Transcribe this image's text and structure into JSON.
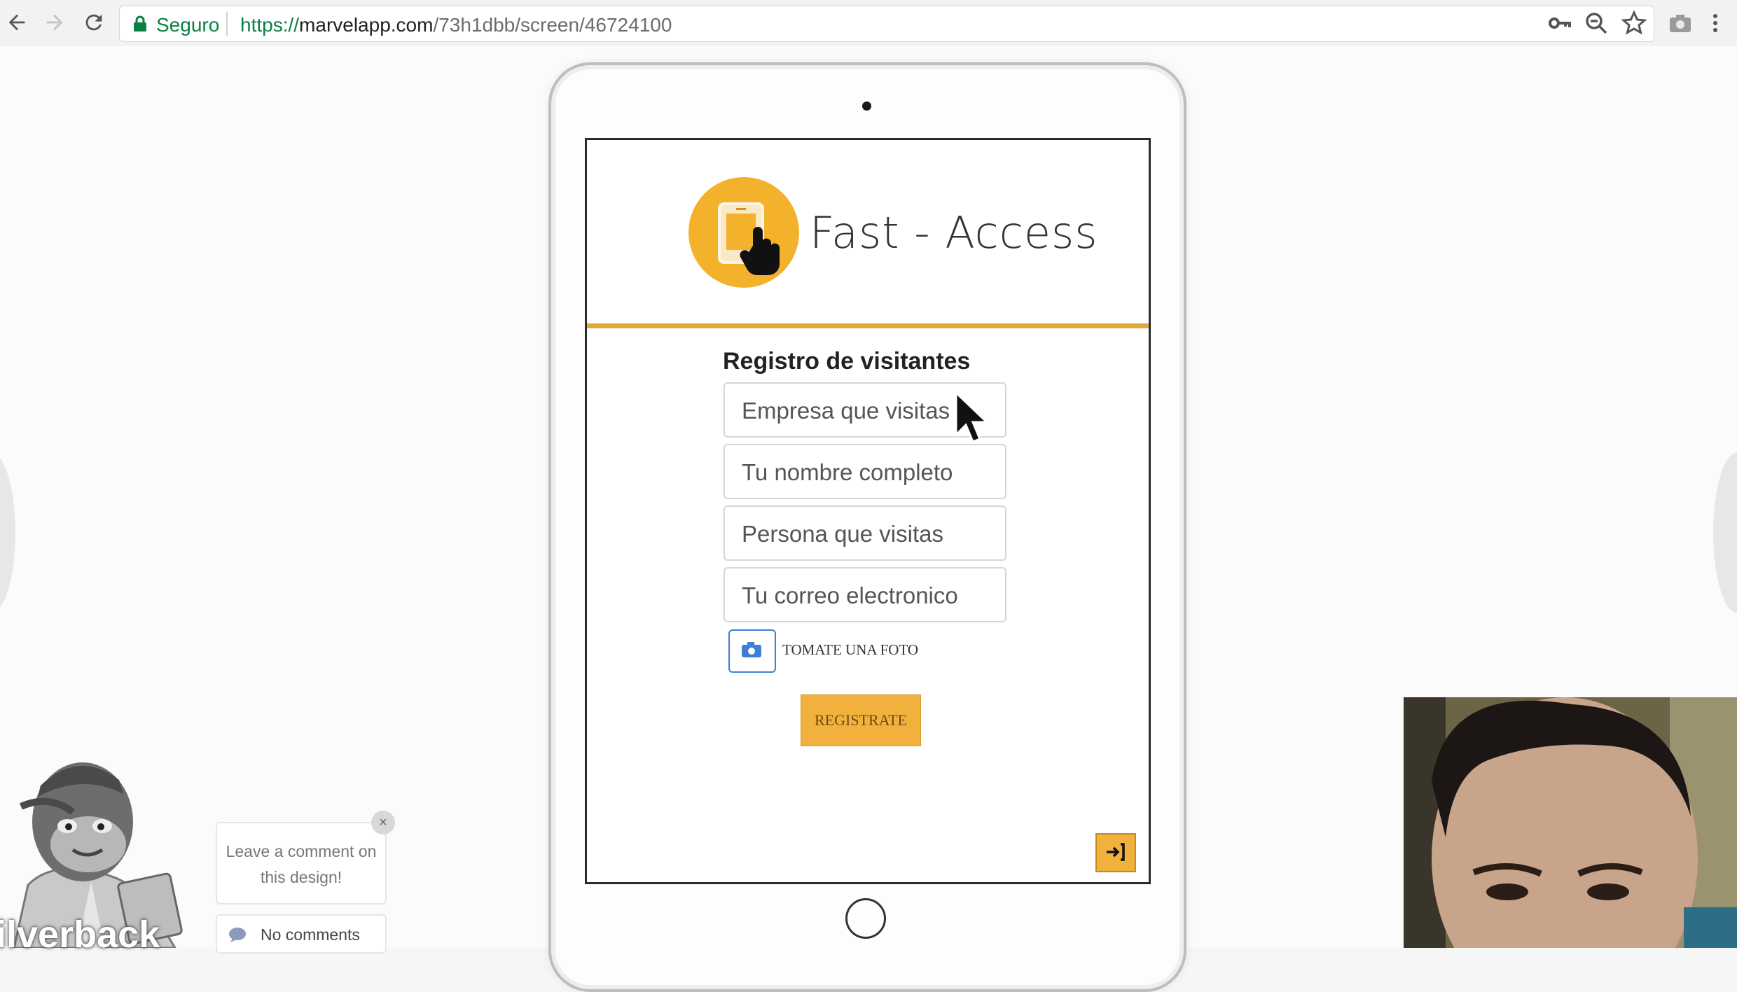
{
  "browser": {
    "secure_label": "Seguro",
    "url_scheme": "https://",
    "url_host": "marvelapp.com",
    "url_path": "/73h1dbb/screen/46724100",
    "icons": [
      "back-arrow-icon",
      "forward-arrow-icon",
      "reload-icon",
      "lock-icon",
      "key-icon",
      "zoom-icon",
      "star-icon",
      "camera-icon",
      "menu-icon"
    ]
  },
  "app": {
    "brand": "Fast - Access",
    "form_title": "Registro de visitantes",
    "fields": [
      {
        "placeholder": "Empresa que visitas"
      },
      {
        "placeholder": "Tu nombre completo"
      },
      {
        "placeholder": "Persona que visitas"
      },
      {
        "placeholder": "Tu correo electronico"
      }
    ],
    "photo_label": "TOMATE UNA FOTO",
    "submit_label": "REGISTRATE",
    "accent_color": "#f2b13c"
  },
  "comments": {
    "prompt": "Leave a comment on this design!",
    "close": "×",
    "count_label": "No comments",
    "brand_tag": "ilverback"
  }
}
